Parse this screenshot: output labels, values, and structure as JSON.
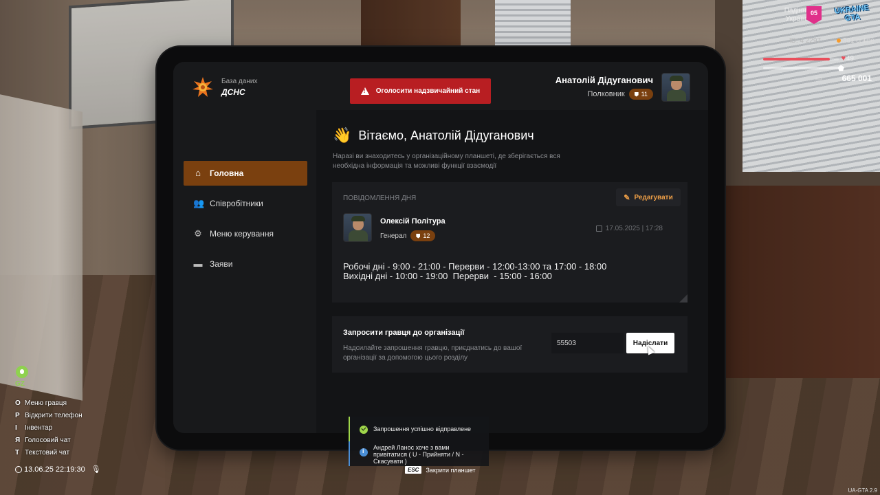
{
  "hud": {
    "server_line1": "Падіння",
    "server_line2": "України",
    "server_badge": "05",
    "logo_line1": "UKRAINE",
    "logo_line2": "GTA",
    "player_id": "ID: 4 2297",
    "online": "381 online",
    "health": "49",
    "health_fraction": 0.88,
    "money": "665 001",
    "money_icon": "wallet-icon",
    "zone": "GZ",
    "keys": [
      {
        "key": "O",
        "label": "Меню гравця"
      },
      {
        "key": "P",
        "label": "Відкрити телефон"
      },
      {
        "key": "I",
        "label": "Інвентар"
      },
      {
        "key": "Я",
        "label": "Голосовий чат"
      },
      {
        "key": "T",
        "label": "Текстовий чат"
      }
    ],
    "datetime": "13.06.25 22:19:30",
    "version": "UA-GTA 2.9"
  },
  "tablet": {
    "brand_sub": "База даних",
    "brand_main": "ДСНС",
    "emergency_button": "Оголосити надзвичайний стан",
    "user": {
      "name": "Анатолій Дідуганович",
      "rank": "Полковник",
      "level": "11"
    },
    "nav": [
      {
        "label": "Головна",
        "icon": "home-icon",
        "active": true
      },
      {
        "label": "Співробітники",
        "icon": "users-icon",
        "active": false
      },
      {
        "label": "Меню керування",
        "icon": "gear-icon",
        "active": false
      },
      {
        "label": "Заяви",
        "icon": "folder-icon",
        "active": false
      }
    ],
    "welcome": "Вітаємо, Анатолій Дідуганович",
    "intro": "Наразі ви знаходитесь у організаційному планшеті, де зберігається вся необхідна інформація та можливі функції взаємодії",
    "message_of_day": {
      "heading": "Повідомлення дня",
      "edit_label": "Редагувати",
      "author_name": "Олексій Політура",
      "author_rank": "Генерал",
      "author_level": "12",
      "date": "17.05.2025 | 17:28",
      "text": "Робочі дні - 9:00 - 21:00 - Перерви - 12:00-13:00 та 17:00 - 18:00\nВихідні дні - 10:00 - 19:00  Перерви  - 15:00 - 16:00"
    },
    "invite": {
      "title": "Запросити гравця до організації",
      "description": "Надсилайте запрошення гравцю, приєднатись до вашої організації за допомогою цього розділу",
      "input_value": "55503",
      "send_label": "Надіслати"
    }
  },
  "notifications": [
    {
      "type": "success",
      "text": "Запрошення успішно відправлене"
    },
    {
      "type": "info",
      "text": "Андрей Ланос хоче з вами привітатися ( U - Прийняти / N - Скасувати )"
    }
  ],
  "esc_hint": {
    "key": "ESC",
    "label": "Закрити планшет"
  },
  "colors": {
    "accent": "#7a400f",
    "emergency": "#b81e22",
    "edit": "#f0a047",
    "success": "#9fd64a",
    "info": "#4a8ed6"
  }
}
